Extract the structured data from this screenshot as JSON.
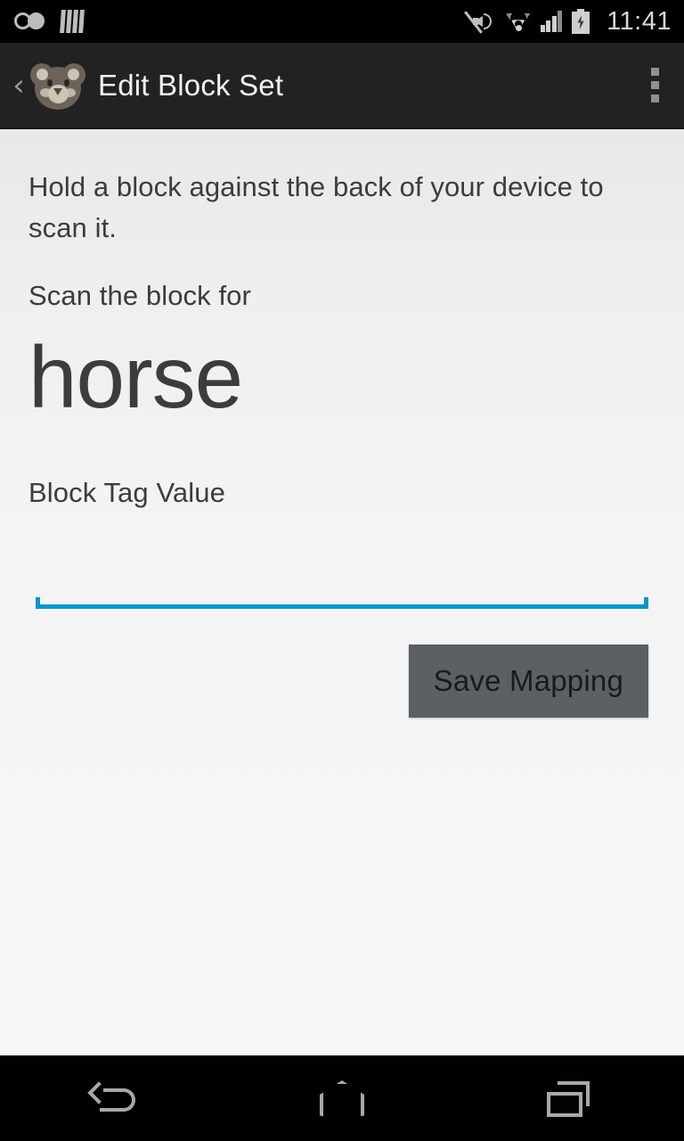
{
  "status_bar": {
    "clock": "11:41",
    "left_icons": [
      {
        "name": "voicemail-icon"
      },
      {
        "name": "barcode-icon"
      }
    ],
    "right_icons": [
      {
        "name": "volume-muted-icon"
      },
      {
        "name": "wifi-icon"
      },
      {
        "name": "cellular-signal-icon"
      },
      {
        "name": "battery-charging-icon"
      }
    ]
  },
  "action_bar": {
    "up_caret": "‹",
    "app_icon": "bear-face-icon",
    "title": "Edit Block Set",
    "overflow": "overflow-menu-icon"
  },
  "main": {
    "instruction": "Hold a block against the back of your device to scan it.",
    "scan_prompt": "Scan the block for",
    "block_word": "horse",
    "field_label": "Block Tag Value",
    "field_value": "",
    "field_placeholder": "",
    "save_label": "Save Mapping"
  },
  "nav_bar": {
    "back": "back-icon",
    "home": "home-icon",
    "recents": "recents-icon"
  },
  "colors": {
    "accent_underline": "#0d96c4",
    "action_bar_bg": "#222222",
    "button_bg": "#5b6065",
    "text_primary": "#3c3c3c",
    "status_bar_bg": "#000000"
  }
}
